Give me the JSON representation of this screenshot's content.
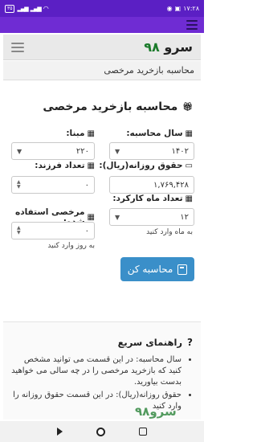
{
  "status": {
    "time": "۱۷:۲۸",
    "battery": "۳۵"
  },
  "brand": {
    "name": "سرو",
    "num": "۹۸"
  },
  "breadcrumb": "محاسبه بازخرید مرخصی",
  "form": {
    "title": "محاسبه بازخرید مرخصی",
    "year_label": "سال محاسبه:",
    "year_value": "۱۴۰۲",
    "mabna_label": "مبنا:",
    "mabna_value": "۲۲۰",
    "wage_label": "حقوق روزانه(ریال):",
    "wage_value": "۱,۷۶۹,۴۲۸",
    "children_label": "تعداد فرزند:",
    "children_value": "۰",
    "months_label": "تعداد ماه کارکرد:",
    "months_value": "۱۲",
    "months_hint": "به ماه وارد کنید",
    "used_label": "مرخصی استفاده شده:",
    "used_value": "۰",
    "used_hint": "به روز وارد کنید",
    "submit_label": "محاسبه کن"
  },
  "guide": {
    "title": "راهنمای سریع",
    "items": [
      "سال محاسبه: در این قسمت می توانید مشخص کنید که بازخرید مرخصی را در چه سالی می خواهید بدست بیاورید.",
      "حقوق روزانه(ریال): در این قسمت حقوق روزانه را وارد کنید"
    ]
  },
  "watermark": "سرو۹۸"
}
